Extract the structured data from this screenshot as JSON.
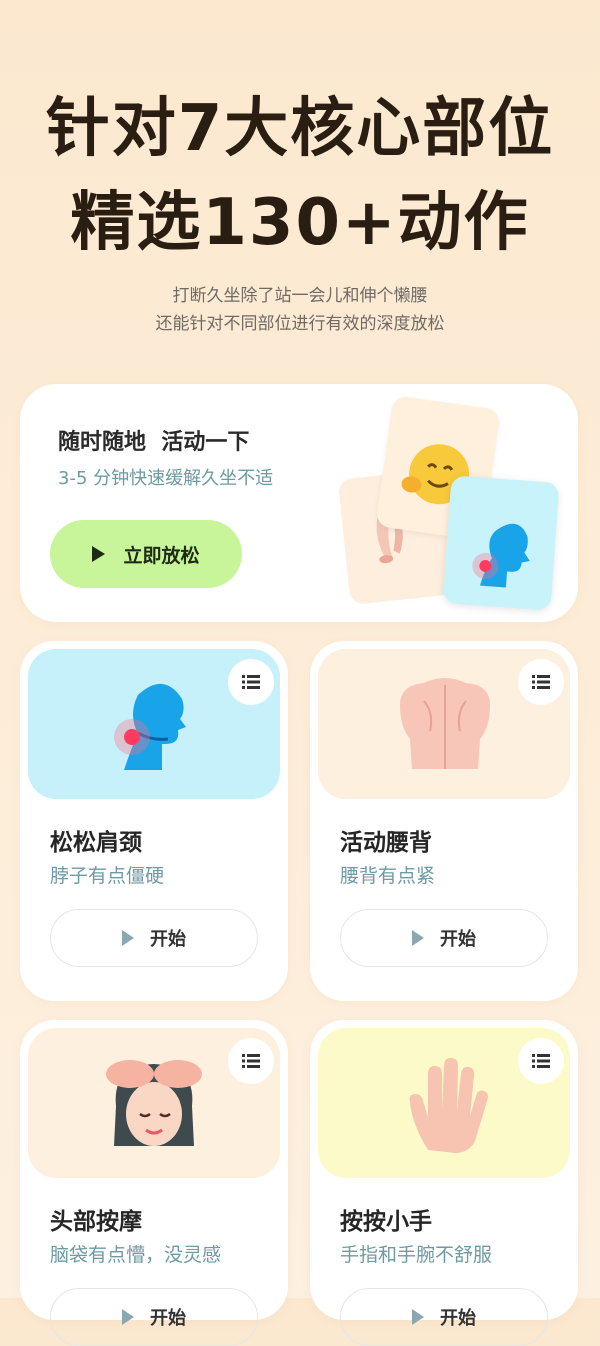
{
  "hero": {
    "title_line1": "针对7大核心部位",
    "title_line2": "精选130+动作",
    "subtitle_line1": "打断久坐除了站一会儿和伸个懒腰",
    "subtitle_line2": "还能针对不同部位进行有效的深度放松"
  },
  "quick_card": {
    "title": "随时随地  活动一下",
    "subtitle": "3-5 分钟快速缓解久坐不适",
    "button_label": "立即放松",
    "icons": [
      "play-icon",
      "smiley-hug-icon",
      "legs-icon",
      "neck-pain-icon"
    ]
  },
  "cards": [
    {
      "title": "松松肩颈",
      "subtitle": "脖子有点僵硬",
      "button_label": "开始",
      "thumb_color": "#c6f1fb",
      "icon": "neck-pain-icon"
    },
    {
      "title": "活动腰背",
      "subtitle": "腰背有点紧",
      "button_label": "开始",
      "thumb_color": "#fdf0de",
      "icon": "back-icon"
    },
    {
      "title": "头部按摩",
      "subtitle": "脑袋有点懵，没灵感",
      "button_label": "开始",
      "thumb_color": "#fdf0de",
      "icon": "head-massage-icon"
    },
    {
      "title": "按按小手",
      "subtitle": "手指和手腕不舒服",
      "button_label": "开始",
      "thumb_color": "#fdfac9",
      "icon": "hand-icon"
    }
  ],
  "colors": {
    "accent_green": "#c8f49a",
    "subtitle_teal": "#6d9aa3",
    "title_dark": "#2a1e12"
  }
}
